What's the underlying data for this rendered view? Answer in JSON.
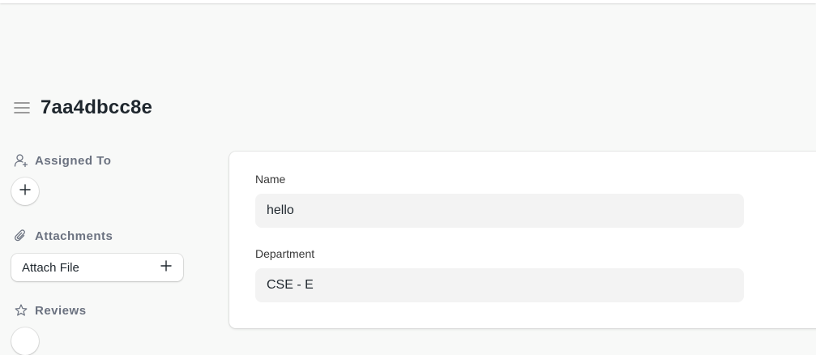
{
  "header": {
    "title": "7aa4dbcc8e"
  },
  "sidebar": {
    "assigned_to": {
      "label": "Assigned To"
    },
    "attachments": {
      "label": "Attachments",
      "attach_button_label": "Attach File"
    },
    "reviews": {
      "label": "Reviews"
    }
  },
  "form": {
    "fields": [
      {
        "label": "Name",
        "value": "hello"
      },
      {
        "label": "Department",
        "value": "CSE - E"
      }
    ]
  },
  "icons": {
    "menu": "hamburger-icon",
    "assign": "user-plus-icon",
    "attach": "paperclip-icon",
    "review": "star-icon",
    "add": "plus-icon"
  }
}
